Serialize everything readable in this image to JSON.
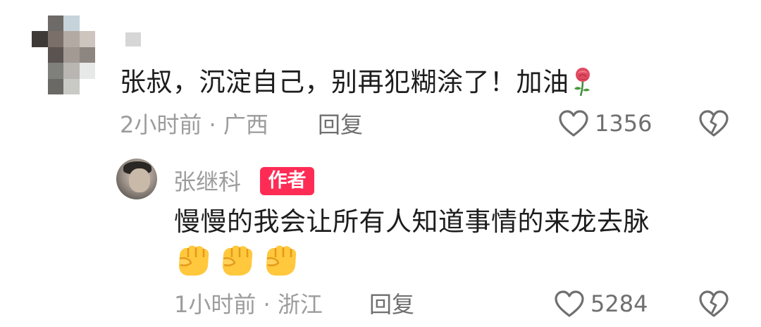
{
  "comment": {
    "text": "张叔，沉淀自己，别再犯糊涂了！加油",
    "emoji": "rose-icon",
    "time": "2小时前",
    "separator": "·",
    "location": "广西",
    "reply_label": "回复",
    "like_count": "1356"
  },
  "reply": {
    "author_name": "张继科",
    "author_badge": "作者",
    "text": "慢慢的我会让所有人知道事情的来龙去脉",
    "emojis": [
      "fist-icon",
      "fist-icon",
      "fist-icon"
    ],
    "time": "1小时前",
    "separator": "·",
    "location": "浙江",
    "reply_label": "回复",
    "like_count": "5284"
  },
  "colors": {
    "text_primary": "#1d1d1d",
    "text_secondary": "#9c9c9c",
    "author_badge": "#fe2c55"
  }
}
